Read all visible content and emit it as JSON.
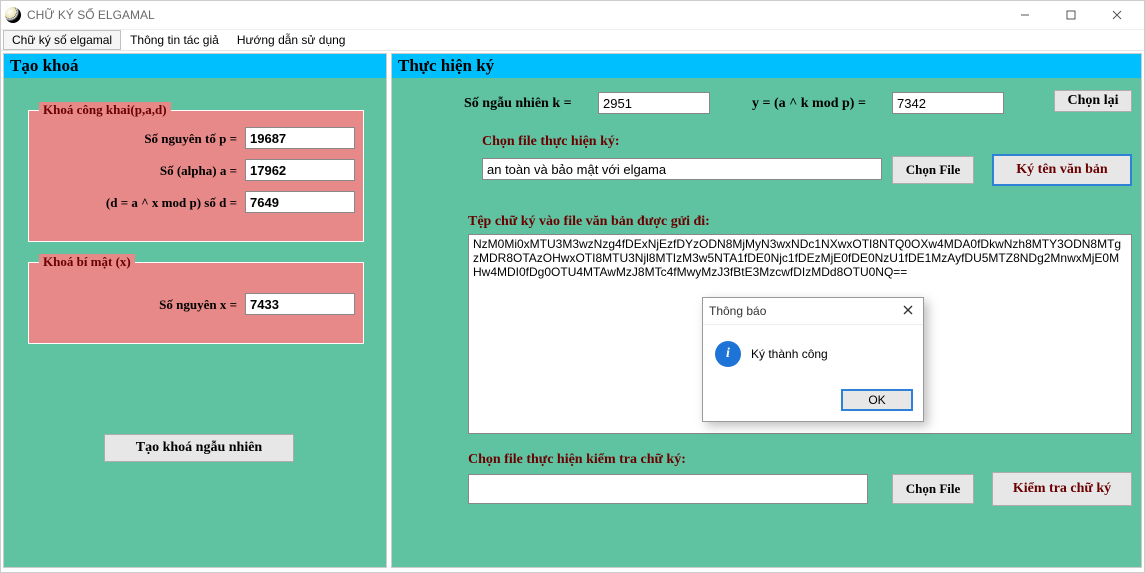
{
  "window": {
    "title": "CHỮ KÝ SỐ ELGAMAL"
  },
  "menu": {
    "items": [
      "Chữ ký số elgamal",
      "Thông tin tác giả",
      "Hướng dẫn sử dụng"
    ]
  },
  "left": {
    "header": "Tạo khoá",
    "pub": {
      "title": "Khoá công khai(p,a,d)",
      "p_label": "Số nguyên tố p =",
      "p_value": "19687",
      "a_label": "Số (alpha) a =",
      "a_value": "17962",
      "d_label": "(d = a ^ x mod p) số d =",
      "d_value": "7649"
    },
    "priv": {
      "title": "Khoá bí mật (x)",
      "x_label": "Số nguyên x =",
      "x_value": "7433"
    },
    "gen_btn": "Tạo khoá ngẫu nhiên"
  },
  "right": {
    "header": "Thực hiện ký",
    "k_label": "Số ngẫu nhiên k =",
    "k_value": "2951",
    "y_label": "y = (a ^ k mod p) =",
    "y_value": "7342",
    "reroll_btn": "Chọn lại",
    "file_sign_label": "Chọn file thực hiện ký:",
    "file_sign_value": "an toàn và bảo mật với elgama",
    "choose_file_btn": "Chọn File",
    "sign_btn": "Ký tên văn bản",
    "sig_label": "Tệp chữ ký vào file văn bản được gửi đi:",
    "sig_value": "NzM0Mi0xMTU3M3wzNzg4fDExNjEzfDYzODN8MjMyN3wxNDc1NXwxOTI8NTQ0OXw4MDA0fDkwNzh8MTY3ODN8MTgzMDR8OTAzOHwxOTI8MTU3Njl8MTIzM3w5NTA1fDE0Njc1fDEzMjE0fDE0NzU1fDE1MzAyfDU5MTZ8NDg2MnwxMjE0MHw4MDI0fDg0OTU4MTAwMzJ8MTc4fMwyMzJ3fBtE3MzcwfDIzMDd8OTU0NQ==",
    "file_verify_label": "Chọn file thực hiện kiểm tra chữ ký:",
    "file_verify_value": "",
    "choose_file_btn2": "Chọn File",
    "verify_btn": "Kiểm tra chữ ký"
  },
  "dialog": {
    "title": "Thông báo",
    "message": "Ký thành công",
    "ok": "OK"
  }
}
